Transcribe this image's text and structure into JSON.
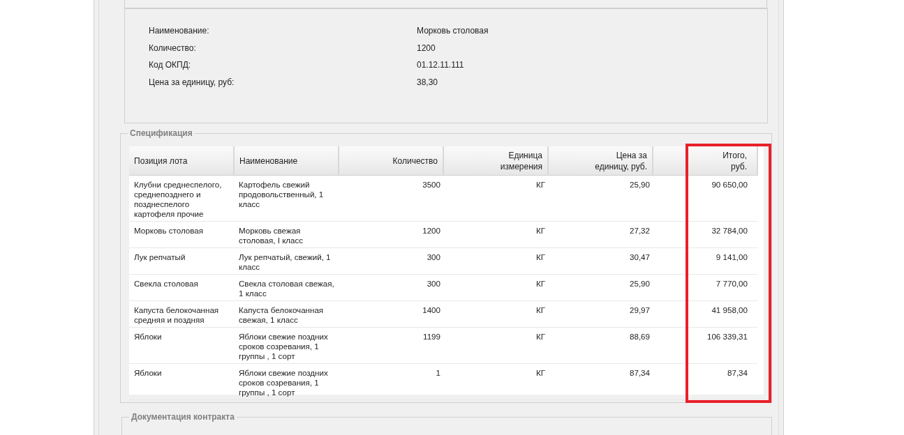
{
  "details": [
    {
      "label": "Наименование:",
      "value": "Морковь столовая"
    },
    {
      "label": "Количество:",
      "value": "1200"
    },
    {
      "label": "Код ОКПД:",
      "value": "01.12.11.111"
    },
    {
      "label": "Цена за единицу, руб:",
      "value": "38,30"
    }
  ],
  "specification": {
    "title": "Спецификация",
    "columns": [
      {
        "label": "Позиция лота",
        "highlighted": false
      },
      {
        "label": "Наименование",
        "highlighted": false
      },
      {
        "label": "Количество",
        "highlighted": false
      },
      {
        "label": "Единица\nизмерения",
        "highlighted": false
      },
      {
        "label": "Цена за\nединицу, руб.",
        "highlighted": false
      },
      {
        "label": "Итого,\nруб.",
        "highlighted": true
      }
    ],
    "rows": [
      [
        "Клубни среднеспелого, среднепозднего и позднеспелого картофеля прочие",
        "Картофель свежий продовольственный, 1 класс",
        "3500",
        "КГ",
        "25,90",
        "90 650,00"
      ],
      [
        "Морковь столовая",
        "Морковь свежая столовая, I класс",
        "1200",
        "КГ",
        "27,32",
        "32 784,00"
      ],
      [
        "Лук репчатый",
        "Лук репчатый, свежий, 1 класс",
        "300",
        "КГ",
        "30,47",
        "9 141,00"
      ],
      [
        "Свекла столовая",
        "Свекла столовая свежая, 1 класс",
        "300",
        "КГ",
        "25,90",
        "7 770,00"
      ],
      [
        "Капуста белокочанная средняя и поздняя",
        "Капуста белокочанная свежая, 1 класс",
        "1400",
        "КГ",
        "29,97",
        "41 958,00"
      ],
      [
        "Яблоки",
        "Яблоки свежие поздних сроков созревания, 1 группы , 1 сорт",
        "1199",
        "КГ",
        "88,69",
        "106 339,31"
      ],
      [
        "Яблоки",
        "Яблоки свежие поздних сроков созревания, 1 группы , 1 сорт",
        "1",
        "КГ",
        "87,34",
        "87,34"
      ]
    ]
  },
  "documentation": {
    "title": "Документация контракта"
  }
}
